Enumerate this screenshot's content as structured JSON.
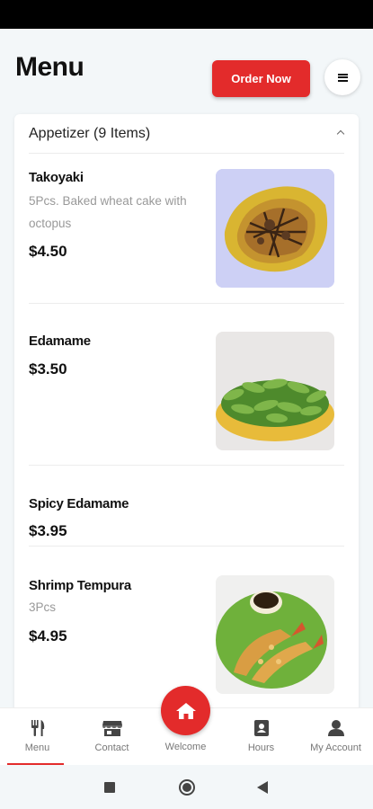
{
  "header": {
    "title": "Menu",
    "order_button": "Order Now",
    "menu_icon": "hamburger-icon"
  },
  "category": {
    "title": "Appetizer (9 Items)",
    "expanded": true,
    "items": [
      {
        "name": "Takoyaki",
        "description": "5Pcs. Baked wheat cake with octopus",
        "price": "$4.50",
        "has_photo": true
      },
      {
        "name": "Edamame",
        "description": "",
        "price": "$3.50",
        "has_photo": true
      },
      {
        "name": "Spicy Edamame",
        "description": "",
        "price": "$3.95",
        "has_photo": false
      },
      {
        "name": "Shrimp Tempura",
        "description": "3Pcs",
        "price": "$4.95",
        "has_photo": true
      }
    ]
  },
  "bottom_nav": {
    "tabs": [
      {
        "label": "Menu",
        "icon": "utensils-icon",
        "active": true
      },
      {
        "label": "Contact",
        "icon": "storefront-icon",
        "active": false
      },
      {
        "label": "Welcome",
        "icon": "home-icon",
        "active": false
      },
      {
        "label": "Hours",
        "icon": "address-book-icon",
        "active": false
      },
      {
        "label": "My Account",
        "icon": "user-icon",
        "active": false
      }
    ]
  },
  "colors": {
    "accent": "#e32b2b",
    "background": "#f3f7f9",
    "card": "#ffffff",
    "muted_text": "#999999"
  }
}
